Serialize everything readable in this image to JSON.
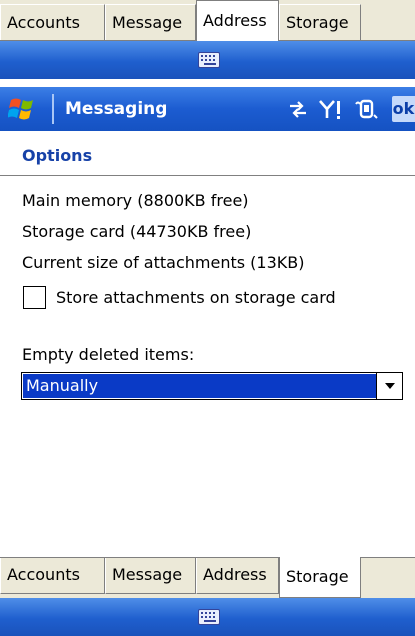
{
  "top_tabs": {
    "tabs": [
      {
        "label": "Accounts"
      },
      {
        "label": "Message"
      },
      {
        "label": "Address"
      },
      {
        "label": "Storage"
      }
    ]
  },
  "titlebar": {
    "app_title": "Messaging",
    "ok_label": "ok",
    "icons": [
      "start-flag-icon",
      "connectivity-icon",
      "signal-icon",
      "phone-icon"
    ]
  },
  "content": {
    "heading": "Options",
    "main_memory": "Main memory (8800KB free)",
    "storage_card": "Storage card (44730KB free)",
    "attachments_size": "Current size of attachments (13KB)",
    "store_attachments_label": "Store attachments on storage card",
    "store_attachments_checked": false,
    "empty_deleted_label": "Empty deleted items:",
    "empty_deleted_value": "Manually"
  },
  "bottom_tabs": {
    "tabs": [
      {
        "label": "Accounts"
      },
      {
        "label": "Message"
      },
      {
        "label": "Address"
      },
      {
        "label": "Storage"
      }
    ]
  },
  "colors": {
    "title_blue": "#1c5cd1",
    "heading_blue": "#1742a8",
    "selection_blue": "#0a3ac6"
  }
}
